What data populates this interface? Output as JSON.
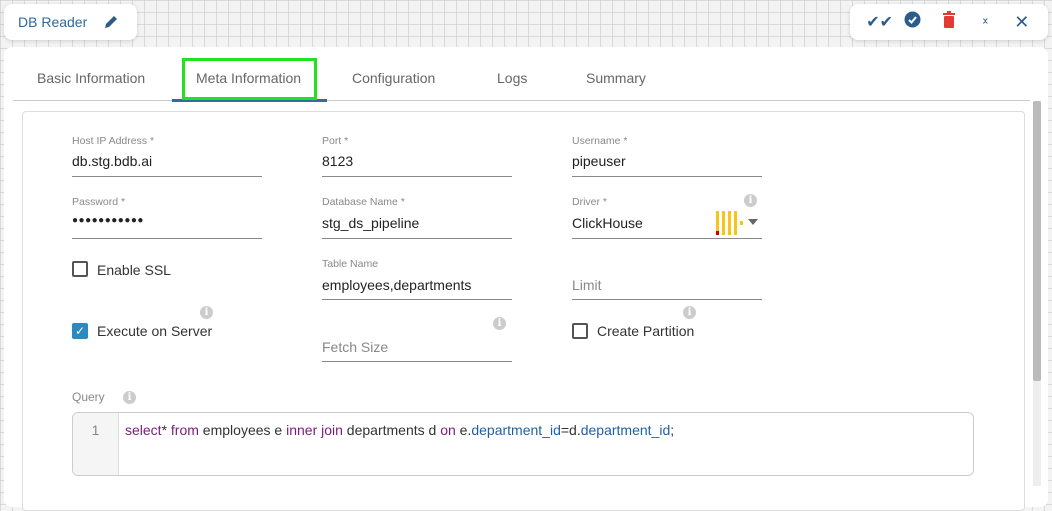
{
  "header": {
    "title": "DB Reader"
  },
  "tabs": [
    "Basic Information",
    "Meta Information",
    "Configuration",
    "Logs",
    "Summary"
  ],
  "active_tab": "Meta Information",
  "form": {
    "host": {
      "label": "Host IP Address *",
      "value": "db.stg.bdb.ai"
    },
    "port": {
      "label": "Port *",
      "value": "8123"
    },
    "username": {
      "label": "Username *",
      "value": "pipeuser"
    },
    "password": {
      "label": "Password *",
      "value": "●●●●●●●●●●●"
    },
    "database": {
      "label": "Database Name *",
      "value": "stg_ds_pipeline"
    },
    "driver": {
      "label": "Driver *",
      "value": "ClickHouse"
    },
    "enable_ssl": {
      "label": "Enable SSL",
      "checked": false
    },
    "table": {
      "label": "Table Name",
      "value": "employees,departments"
    },
    "limit": {
      "placeholder": "Limit"
    },
    "execute_on_server": {
      "label": "Execute on Server",
      "checked": true
    },
    "fetch_size": {
      "placeholder": "Fetch Size"
    },
    "create_partition": {
      "label": "Create Partition",
      "checked": false
    },
    "query": {
      "label": "Query",
      "line_number": "1",
      "tokens": [
        [
          "kw",
          "select"
        ],
        [
          "",
          "* "
        ],
        [
          "kw",
          "from"
        ],
        [
          "",
          " employees e "
        ],
        [
          "kw",
          "inner join"
        ],
        [
          "",
          " departments d "
        ],
        [
          "kw",
          "on"
        ],
        [
          "",
          " e."
        ],
        [
          "pr",
          "department_id"
        ],
        [
          "",
          "=d."
        ],
        [
          "pr",
          "department_id"
        ],
        [
          "",
          ";"
        ]
      ]
    }
  }
}
